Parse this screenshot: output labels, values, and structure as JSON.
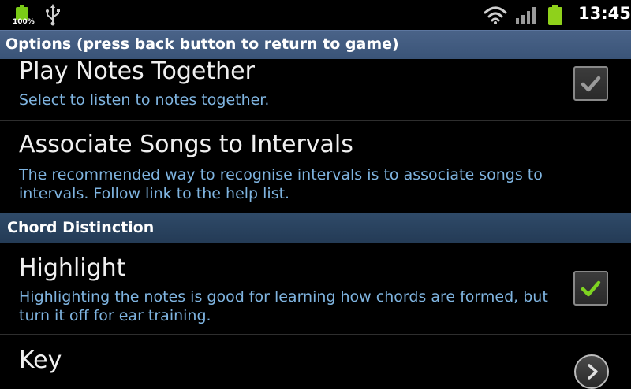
{
  "status_bar": {
    "battery_percent_label": "100%",
    "time": "13:45",
    "icons": [
      "battery-icon",
      "usb-icon",
      "wifi-icon",
      "signal-icon",
      "battery-icon"
    ]
  },
  "title_bar": {
    "title": "Options (press back button to return to game)"
  },
  "preferences": [
    {
      "title": "Play Notes Together",
      "summary": "Select to listen to notes together.",
      "widget": "checkbox",
      "checked": true,
      "enabled": false
    },
    {
      "title": "Associate Songs to Intervals",
      "summary": "The recommended way to recognise intervals is to associate songs to intervals. Follow link to the help list.",
      "widget": "none"
    }
  ],
  "category": {
    "label": "Chord Distinction"
  },
  "chord_preferences": [
    {
      "title": "Highlight",
      "summary": "Highlighting the notes is good for learning how chords are formed, but turn it off for ear training.",
      "widget": "checkbox",
      "checked": true,
      "enabled": true
    },
    {
      "title": "Key",
      "widget": "chevron"
    }
  ],
  "colors": {
    "title_bar": "#3f5a80",
    "category_header": "#2a4360",
    "summary_text": "#7fb4e0",
    "check_green": "#7ed321",
    "check_gray": "#9a9a9a"
  }
}
